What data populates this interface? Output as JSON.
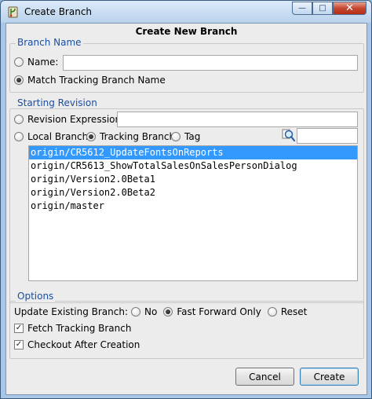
{
  "window": {
    "title": "Create Branch",
    "minimize_glyph": "—",
    "maximize_glyph": "□",
    "close_glyph": "✕"
  },
  "dialog": {
    "heading": "Create New Branch"
  },
  "branch_name": {
    "legend": "Branch Name",
    "name_label": "Name:",
    "name_value": "",
    "match_label": "Match Tracking Branch Name",
    "selected": "match"
  },
  "starting_revision": {
    "legend": "Starting Revision",
    "revision_expression_label": "Revision Expression:",
    "revision_expression_value": "",
    "local_branch_label": "Local Branch",
    "tracking_branch_label": "Tracking Branch",
    "tag_label": "Tag",
    "selected": "tracking",
    "filter_value": "",
    "branches": [
      "origin/CR5612_UpdateFontsOnReports",
      "origin/CR5613_ShowTotalSalesOnSalesPersonDialog",
      "origin/Version2.0Beta1",
      "origin/Version2.0Beta2",
      "origin/master"
    ],
    "selected_branch_index": 0
  },
  "options": {
    "legend": "Options",
    "update_existing_label": "Update Existing Branch:",
    "no_label": "No",
    "fast_forward_label": "Fast Forward Only",
    "reset_label": "Reset",
    "update_selected": "fast_forward",
    "fetch_tracking_label": "Fetch Tracking Branch",
    "fetch_tracking_checked": true,
    "checkout_after_label": "Checkout After Creation",
    "checkout_after_checked": true
  },
  "buttons": {
    "cancel": "Cancel",
    "create": "Create"
  },
  "colors": {
    "accent": "#1a4ea3",
    "selection": "#3399ff",
    "close_button": "#c5472f"
  }
}
